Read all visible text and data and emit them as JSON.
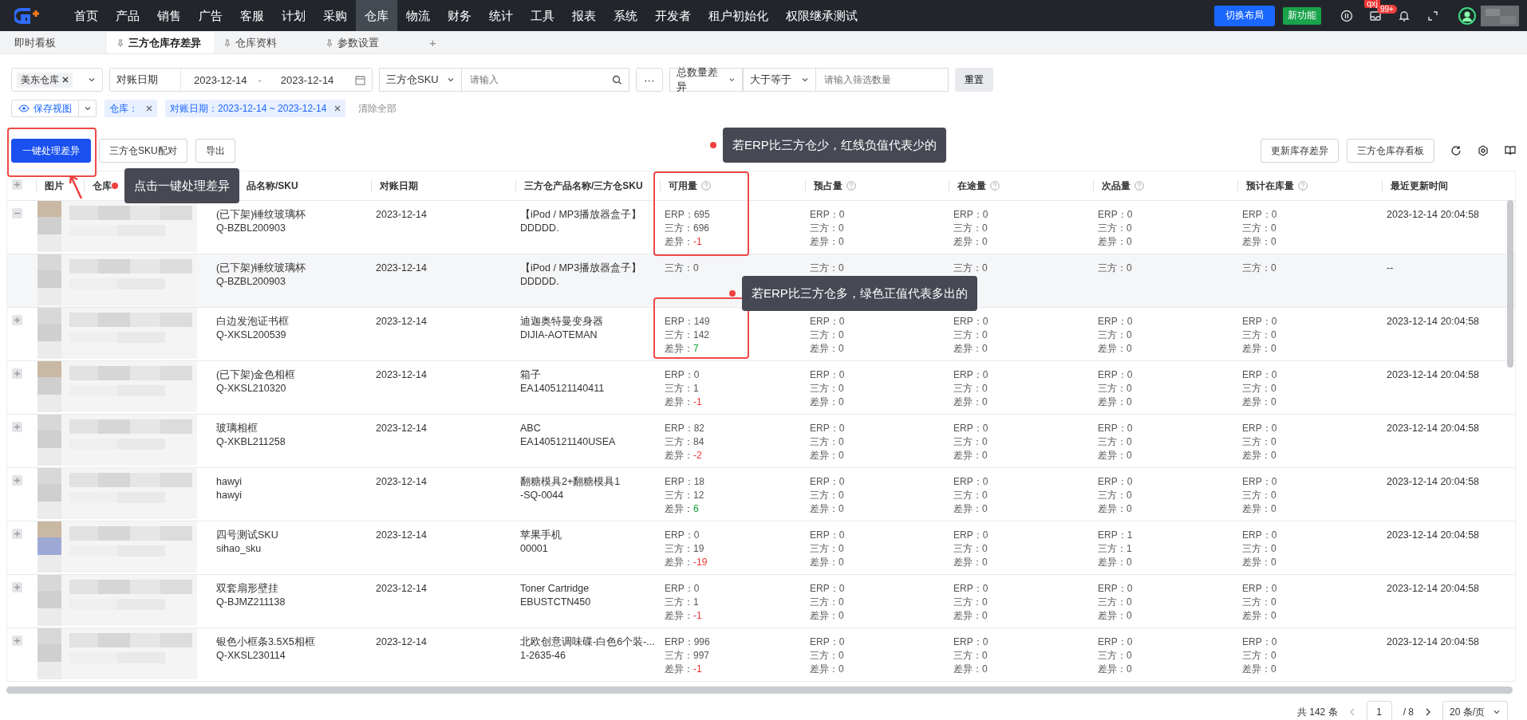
{
  "nav": {
    "items": [
      {
        "label": "首页",
        "selected": false
      },
      {
        "label": "产品",
        "selected": false
      },
      {
        "label": "销售",
        "selected": false
      },
      {
        "label": "广告",
        "selected": false
      },
      {
        "label": "客服",
        "selected": false
      },
      {
        "label": "计划",
        "selected": false
      },
      {
        "label": "采购",
        "selected": false
      },
      {
        "label": "仓库",
        "selected": true
      },
      {
        "label": "物流",
        "selected": false
      },
      {
        "label": "财务",
        "selected": false
      },
      {
        "label": "统计",
        "selected": false
      },
      {
        "label": "工具",
        "selected": false
      },
      {
        "label": "报表",
        "selected": false
      },
      {
        "label": "系统",
        "selected": false
      },
      {
        "label": "开发者",
        "selected": false
      },
      {
        "label": "租户初始化",
        "selected": false
      },
      {
        "label": "权限继承测试",
        "selected": false
      }
    ],
    "switch_layout": "切换布局",
    "new_feature": "新功能",
    "user_badge": "qxj",
    "message_count": "99+",
    "avatar": {
      "kind": "picture"
    }
  },
  "tabs": [
    {
      "label": "即时看板",
      "selected": false,
      "pinned": false
    },
    {
      "label": "三方仓库存差异",
      "selected": true,
      "pinned": true
    },
    {
      "label": "仓库资料",
      "selected": false,
      "pinned": true
    },
    {
      "label": "参数设置",
      "selected": false,
      "pinned": true
    }
  ],
  "new_tab": "+",
  "filters": {
    "warehouse": "美东仓库",
    "date_label": "对账日期",
    "date_start": "2023-12-14",
    "date_sep": "-",
    "date_end": "2023-12-14",
    "sku_type": "三方仓SKU",
    "search_placeholder": "请输入",
    "more": "···",
    "diff_type": "总数量差异",
    "operator": "大于等于",
    "qty_placeholder": "请输入筛选数量",
    "reset": "重置"
  },
  "view": {
    "save": "保存视图",
    "tags": [
      "仓库：",
      "对账日期：2023-12-14 ~ 2023-12-14"
    ],
    "clear": "清除全部"
  },
  "actions": {
    "left": [
      "一键处理差异",
      "三方仓SKU配对",
      "导出"
    ],
    "right": [
      "更新库存差异",
      "三方仓库存看板"
    ]
  },
  "table": {
    "columns": [
      {
        "label": "图片",
        "help": false
      },
      {
        "label": "仓库",
        "help": false
      },
      {
        "label": "品名称/SKU",
        "help": false
      },
      {
        "label": "对账日期",
        "help": false
      },
      {
        "label": "三方仓产品名称/三方仓SKU",
        "help": false
      },
      {
        "label": "可用量",
        "help": true
      },
      {
        "label": "预占量",
        "help": true
      },
      {
        "label": "在途量",
        "help": true
      },
      {
        "label": "次品量",
        "help": true
      },
      {
        "label": "预计在库量",
        "help": true
      },
      {
        "label": "最近更新时间",
        "help": false
      }
    ],
    "rows": [
      {
        "kind": "parent",
        "expanded": true,
        "thumbnail": {
          "kind": "picture"
        },
        "product": "(已下架)锤纹玻璃杯",
        "sku": "Q-BZBL200903",
        "date": "2023-12-14",
        "tp_product": "【iPod / MP3播放器盒子】",
        "tp_sku": "DDDDD.",
        "stats": [
          [
            {
              "label": "ERP：",
              "value": "695"
            },
            {
              "label": "三方：",
              "value": "696"
            },
            {
              "label": "差异：",
              "value": "-1",
              "color": "#f03030"
            }
          ],
          [
            {
              "label": "ERP：",
              "value": "0"
            },
            {
              "label": "三方：",
              "value": "0"
            },
            {
              "label": "差异：",
              "value": "0"
            }
          ],
          [
            {
              "label": "ERP：",
              "value": "0"
            },
            {
              "label": "三方：",
              "value": "0"
            },
            {
              "label": "差异：",
              "value": "0"
            }
          ],
          [
            {
              "label": "ERP：",
              "value": "0"
            },
            {
              "label": "三方：",
              "value": "0"
            },
            {
              "label": "差异：",
              "value": "0"
            }
          ],
          [
            {
              "label": "ERP：",
              "value": "0"
            },
            {
              "label": "三方：",
              "value": "0"
            },
            {
              "label": "差异：",
              "value": "0"
            }
          ]
        ],
        "updated": "2023-12-14 20:04:58"
      },
      {
        "kind": "child",
        "thumbnail": {
          "kind": "picture"
        },
        "product": "(已下架)锤纹玻璃杯",
        "sku": "Q-BZBL200903",
        "date": "2023-12-14",
        "tp_product": "【iPod / MP3播放器盒子】",
        "tp_sku": "DDDDD.",
        "stats": [
          [
            {
              "label": "三方：",
              "value": "0"
            }
          ],
          [
            {
              "label": "三方：",
              "value": "0"
            }
          ],
          [
            {
              "label": "三方：",
              "value": "0"
            }
          ],
          [
            {
              "label": "三方：",
              "value": "0"
            }
          ],
          [
            {
              "label": "三方：",
              "value": "0"
            }
          ]
        ],
        "updated": "--"
      },
      {
        "kind": "parent",
        "expanded": false,
        "thumbnail": {
          "kind": "picture"
        },
        "product": "白边发泡证书框",
        "sku": "Q-XKSL200539",
        "date": "2023-12-14",
        "tp_product": "迪迦奥特曼变身器",
        "tp_sku": "DIJIA-AOTEMAN",
        "stats": [
          [
            {
              "label": "ERP：",
              "value": "149"
            },
            {
              "label": "三方：",
              "value": "142"
            },
            {
              "label": "差异：",
              "value": "7",
              "color": "#10a030"
            }
          ],
          [
            {
              "label": "ERP：",
              "value": "0"
            },
            {
              "label": "三方：",
              "value": "0"
            },
            {
              "label": "差异：",
              "value": "0"
            }
          ],
          [
            {
              "label": "ERP：",
              "value": "0"
            },
            {
              "label": "三方：",
              "value": "0"
            },
            {
              "label": "差异：",
              "value": "0"
            }
          ],
          [
            {
              "label": "ERP：",
              "value": "0"
            },
            {
              "label": "三方：",
              "value": "0"
            },
            {
              "label": "差异：",
              "value": "0"
            }
          ],
          [
            {
              "label": "ERP：",
              "value": "0"
            },
            {
              "label": "三方：",
              "value": "0"
            },
            {
              "label": "差异：",
              "value": "0"
            }
          ]
        ],
        "updated": "2023-12-14 20:04:58"
      },
      {
        "kind": "parent",
        "expanded": false,
        "thumbnail": {
          "kind": "picture"
        },
        "product": "(已下架)金色相框",
        "sku": "Q-XKSL210320",
        "date": "2023-12-14",
        "tp_product": "箱子",
        "tp_sku": "EA1405121140411",
        "stats": [
          [
            {
              "label": "ERP：",
              "value": "0"
            },
            {
              "label": "三方：",
              "value": "1"
            },
            {
              "label": "差异：",
              "value": "-1",
              "color": "#f03030"
            }
          ],
          [
            {
              "label": "ERP：",
              "value": "0"
            },
            {
              "label": "三方：",
              "value": "0"
            },
            {
              "label": "差异：",
              "value": "0"
            }
          ],
          [
            {
              "label": "ERP：",
              "value": "0"
            },
            {
              "label": "三方：",
              "value": "0"
            },
            {
              "label": "差异：",
              "value": "0"
            }
          ],
          [
            {
              "label": "ERP：",
              "value": "0"
            },
            {
              "label": "三方：",
              "value": "0"
            },
            {
              "label": "差异：",
              "value": "0"
            }
          ],
          [
            {
              "label": "ERP：",
              "value": "0"
            },
            {
              "label": "三方：",
              "value": "0"
            },
            {
              "label": "差异：",
              "value": "0"
            }
          ]
        ],
        "updated": "2023-12-14 20:04:58"
      },
      {
        "kind": "parent",
        "expanded": false,
        "thumbnail": {
          "kind": "picture"
        },
        "product": "玻璃相框",
        "sku": "Q-XKBL211258",
        "date": "2023-12-14",
        "tp_product": "ABC",
        "tp_sku": "EA1405121140USEA",
        "stats": [
          [
            {
              "label": "ERP：",
              "value": "82"
            },
            {
              "label": "三方：",
              "value": "84"
            },
            {
              "label": "差异：",
              "value": "-2",
              "color": "#f03030"
            }
          ],
          [
            {
              "label": "ERP：",
              "value": "0"
            },
            {
              "label": "三方：",
              "value": "0"
            },
            {
              "label": "差异：",
              "value": "0"
            }
          ],
          [
            {
              "label": "ERP：",
              "value": "0"
            },
            {
              "label": "三方：",
              "value": "0"
            },
            {
              "label": "差异：",
              "value": "0"
            }
          ],
          [
            {
              "label": "ERP：",
              "value": "0"
            },
            {
              "label": "三方：",
              "value": "0"
            },
            {
              "label": "差异：",
              "value": "0"
            }
          ],
          [
            {
              "label": "ERP：",
              "value": "0"
            },
            {
              "label": "三方：",
              "value": "0"
            },
            {
              "label": "差异：",
              "value": "0"
            }
          ]
        ],
        "updated": "2023-12-14 20:04:58"
      },
      {
        "kind": "parent",
        "expanded": false,
        "thumbnail": {
          "kind": "picture"
        },
        "product": "hawyi",
        "sku": "hawyi",
        "date": "2023-12-14",
        "tp_product": "翻糖模具2+翻糖模具1",
        "tp_sku": "-SQ-0044",
        "stats": [
          [
            {
              "label": "ERP：",
              "value": "18"
            },
            {
              "label": "三方：",
              "value": "12"
            },
            {
              "label": "差异：",
              "value": "6",
              "color": "#10a030"
            }
          ],
          [
            {
              "label": "ERP：",
              "value": "0"
            },
            {
              "label": "三方：",
              "value": "0"
            },
            {
              "label": "差异：",
              "value": "0"
            }
          ],
          [
            {
              "label": "ERP：",
              "value": "0"
            },
            {
              "label": "三方：",
              "value": "0"
            },
            {
              "label": "差异：",
              "value": "0"
            }
          ],
          [
            {
              "label": "ERP：",
              "value": "0"
            },
            {
              "label": "三方：",
              "value": "0"
            },
            {
              "label": "差异：",
              "value": "0"
            }
          ],
          [
            {
              "label": "ERP：",
              "value": "0"
            },
            {
              "label": "三方：",
              "value": "0"
            },
            {
              "label": "差异：",
              "value": "0"
            }
          ]
        ],
        "updated": "2023-12-14 20:04:58"
      },
      {
        "kind": "parent",
        "expanded": false,
        "thumbnail": {
          "kind": "picture"
        },
        "product": "四号测试SKU",
        "sku": "sihao_sku",
        "date": "2023-12-14",
        "tp_product": "苹果手机",
        "tp_sku": "00001",
        "stats": [
          [
            {
              "label": "ERP：",
              "value": "0"
            },
            {
              "label": "三方：",
              "value": "19"
            },
            {
              "label": "差异：",
              "value": "-19",
              "color": "#f03030"
            }
          ],
          [
            {
              "label": "ERP：",
              "value": "0"
            },
            {
              "label": "三方：",
              "value": "0"
            },
            {
              "label": "差异：",
              "value": "0"
            }
          ],
          [
            {
              "label": "ERP：",
              "value": "0"
            },
            {
              "label": "三方：",
              "value": "0"
            },
            {
              "label": "差异：",
              "value": "0"
            }
          ],
          [
            {
              "label": "ERP：",
              "value": "1"
            },
            {
              "label": "三方：",
              "value": "1"
            },
            {
              "label": "差异：",
              "value": "0"
            }
          ],
          [
            {
              "label": "ERP：",
              "value": "0"
            },
            {
              "label": "三方：",
              "value": "0"
            },
            {
              "label": "差异：",
              "value": "0"
            }
          ]
        ],
        "updated": "2023-12-14 20:04:58"
      },
      {
        "kind": "parent",
        "expanded": false,
        "thumbnail": {
          "kind": "picture"
        },
        "product": "双套扇形壁挂",
        "sku": "Q-BJMZ211138",
        "date": "2023-12-14",
        "tp_product": "Toner Cartridge",
        "tp_sku": "EBUSTCTN450",
        "stats": [
          [
            {
              "label": "ERP：",
              "value": "0"
            },
            {
              "label": "三方：",
              "value": "1"
            },
            {
              "label": "差异：",
              "value": "-1",
              "color": "#f03030"
            }
          ],
          [
            {
              "label": "ERP：",
              "value": "0"
            },
            {
              "label": "三方：",
              "value": "0"
            },
            {
              "label": "差异：",
              "value": "0"
            }
          ],
          [
            {
              "label": "ERP：",
              "value": "0"
            },
            {
              "label": "三方：",
              "value": "0"
            },
            {
              "label": "差异：",
              "value": "0"
            }
          ],
          [
            {
              "label": "ERP：",
              "value": "0"
            },
            {
              "label": "三方：",
              "value": "0"
            },
            {
              "label": "差异：",
              "value": "0"
            }
          ],
          [
            {
              "label": "ERP：",
              "value": "0"
            },
            {
              "label": "三方：",
              "value": "0"
            },
            {
              "label": "差异：",
              "value": "0"
            }
          ]
        ],
        "updated": "2023-12-14 20:04:58"
      },
      {
        "kind": "parent",
        "expanded": false,
        "thumbnail": {
          "kind": "picture"
        },
        "product": "银色小框条3.5X5相框",
        "sku": "Q-XKSL230114",
        "date": "2023-12-14",
        "tp_product": "北欧创意调味碟-白色6个装-...",
        "tp_sku": "1-2635-46",
        "stats": [
          [
            {
              "label": "ERP：",
              "value": "996"
            },
            {
              "label": "三方：",
              "value": "997"
            },
            {
              "label": "差异：",
              "value": "-1",
              "color": "#f03030"
            }
          ],
          [
            {
              "label": "ERP：",
              "value": "0"
            },
            {
              "label": "三方：",
              "value": "0"
            },
            {
              "label": "差异：",
              "value": "0"
            }
          ],
          [
            {
              "label": "ERP：",
              "value": "0"
            },
            {
              "label": "三方：",
              "value": "0"
            },
            {
              "label": "差异：",
              "value": "0"
            }
          ],
          [
            {
              "label": "ERP：",
              "value": "0"
            },
            {
              "label": "三方：",
              "value": "0"
            },
            {
              "label": "差异：",
              "value": "0"
            }
          ],
          [
            {
              "label": "ERP：",
              "value": "0"
            },
            {
              "label": "三方：",
              "value": "0"
            },
            {
              "label": "差异：",
              "value": "0"
            }
          ]
        ],
        "updated": "2023-12-14 20:04:58"
      }
    ]
  },
  "pagination": {
    "total": "共 142 条",
    "page": "1",
    "pages": "/ 8",
    "page_size": "20 条/页"
  },
  "annotations": [
    "点击一键处理差异",
    "若ERP比三方仓少，红线负值代表少的",
    "若ERP比三方仓多，绿色正值代表多出的"
  ]
}
